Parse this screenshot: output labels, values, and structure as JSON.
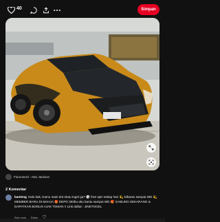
{
  "header": {
    "like_count": "40",
    "save_label": "Simpan"
  },
  "pin": {
    "credit": "Fluoronerd - Alex Jackson"
  },
  "comments": {
    "title": "2 Komentar",
    "items": [
      {
        "user": "banteng",
        "text": "Halo kak, Kamu main dot strau togel ga? 🎲 free spin setiap hari 💫 Dibantu sampai WD 💫 MEMBER BARU DI MAHJA 🎁 DEPO 30ribu aku bantu sampai WD 🎁 GABUNG SEKARANG & DAPATKAN BONUS AJAK TEMAN !! Link daftar : JINETOGEL",
        "time": "Baru saja",
        "reply_label": "Balas"
      }
    ]
  },
  "icons": {
    "like": "heart-icon",
    "comment": "chat-icon",
    "share": "share-icon",
    "more": "more-icon",
    "expand": "expand-icon",
    "lens": "lens-icon"
  },
  "colors": {
    "accent": "#e60023",
    "background": "#111111",
    "car_orange": "#c98a1a"
  }
}
